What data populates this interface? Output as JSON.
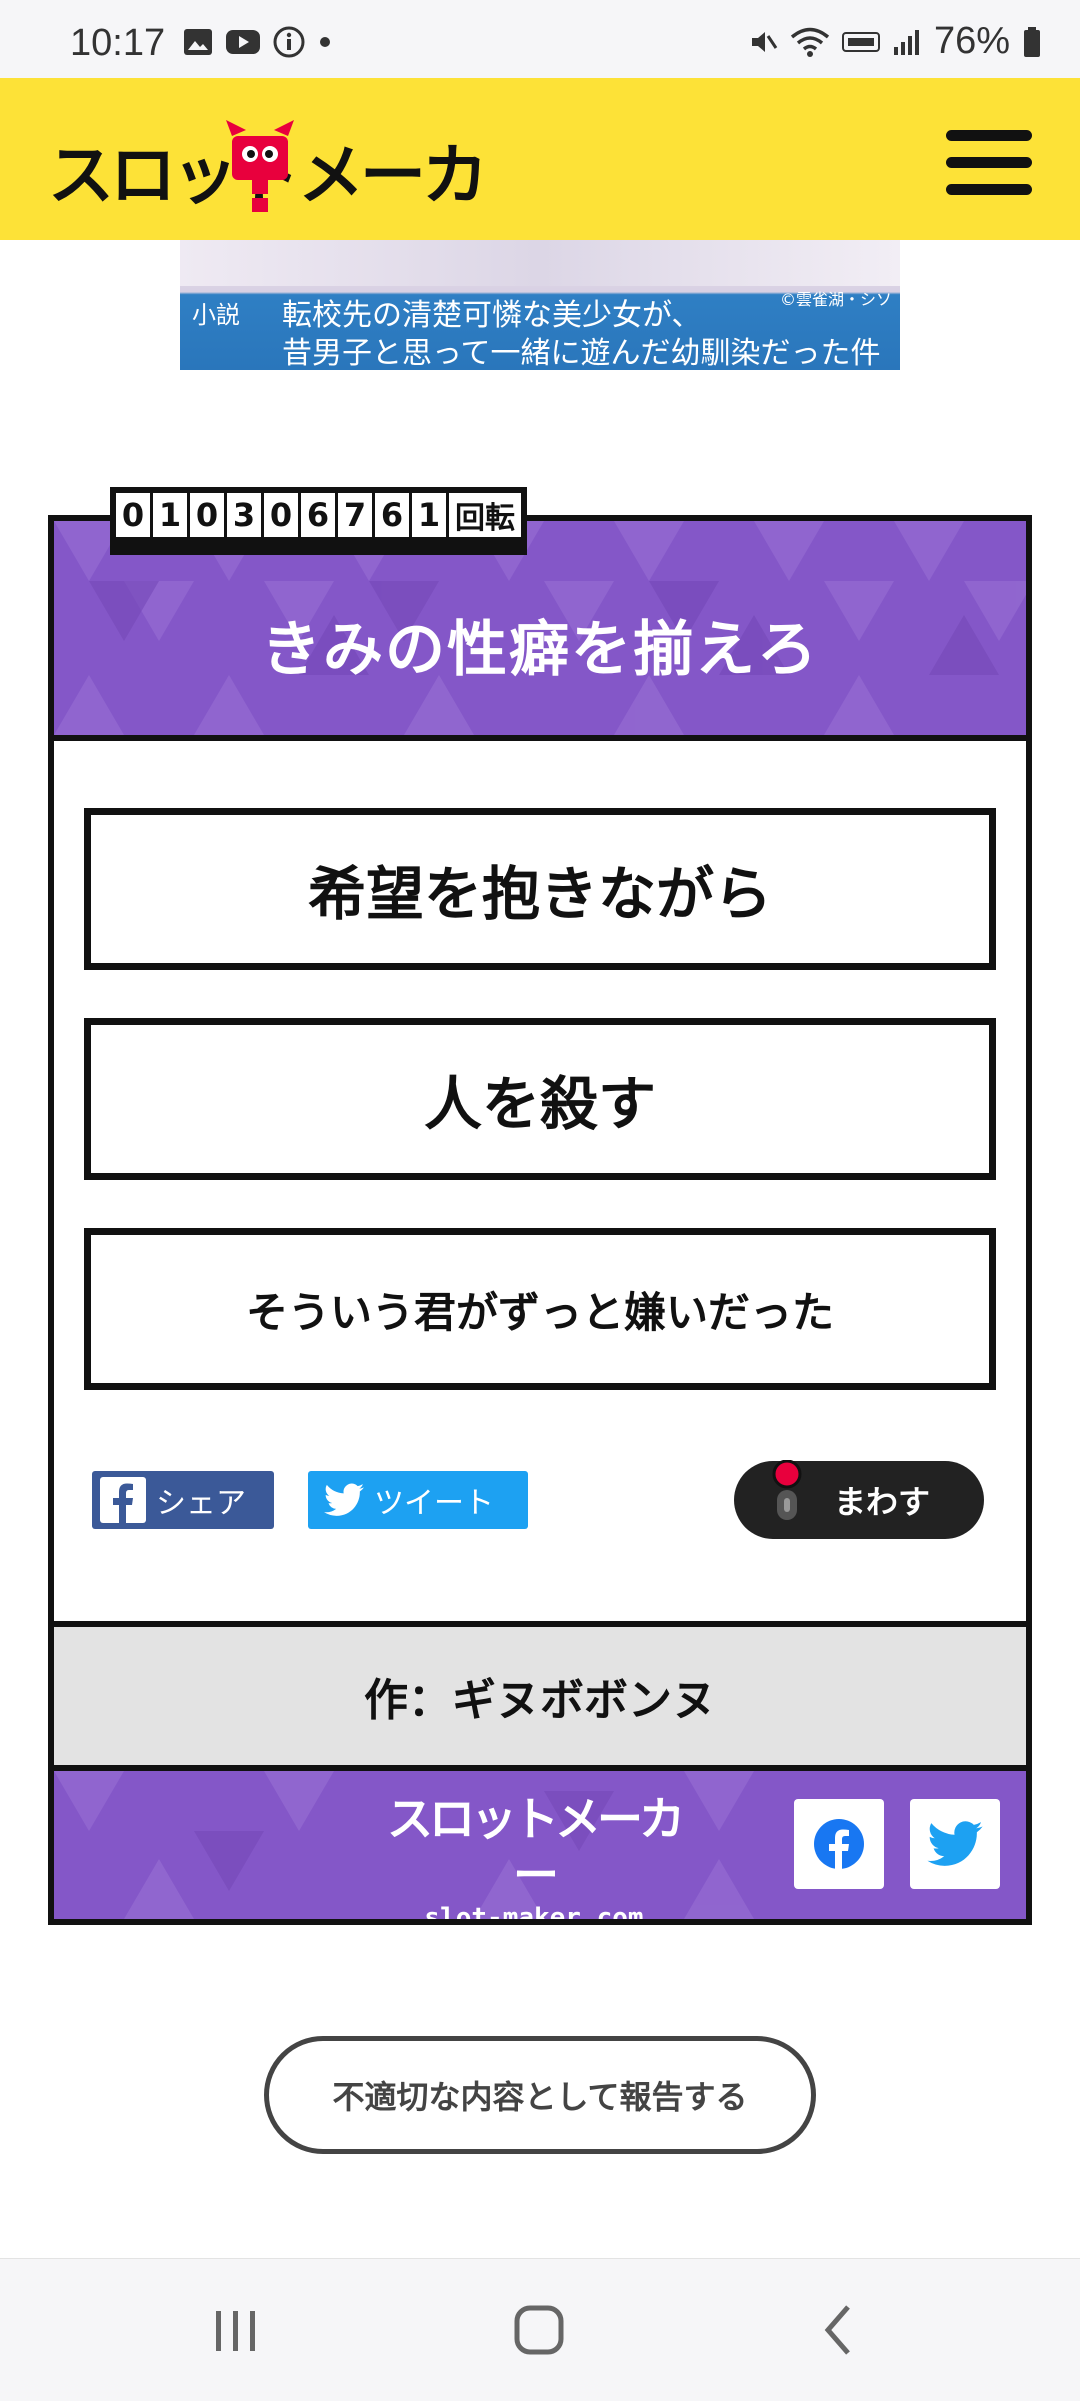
{
  "status_bar": {
    "time": "10:17",
    "battery": "76%"
  },
  "header": {
    "logo_text": "スロットメーカー"
  },
  "ad": {
    "tag": "小説",
    "line1": "転校先の清楚可憐な美少女が、",
    "line2": "昔男子と思って一緒に遊んだ幼馴染だった件",
    "credit": "©雲雀湖・シソ"
  },
  "slot": {
    "counter_digits": [
      "0",
      "1",
      "0",
      "3",
      "0",
      "6",
      "7",
      "6",
      "1"
    ],
    "counter_unit": "回転",
    "title": "きみの性癖を揃えろ",
    "reels": [
      "希望を抱きながら",
      "人を殺す",
      "そういう君がずっと嫌いだった"
    ],
    "share_facebook": "シェア",
    "share_twitter": "ツイート",
    "spin_label": "まわす",
    "author": "作：ギヌボボンヌ",
    "footer_logo": "スロットメーカー",
    "footer_url": "slot-maker.com"
  },
  "report_label": "不適切な内容として報告する",
  "colors": {
    "header_yellow": "#fde237",
    "card_purple": "#8457c8",
    "spin_red_dot": "#e8003d"
  }
}
